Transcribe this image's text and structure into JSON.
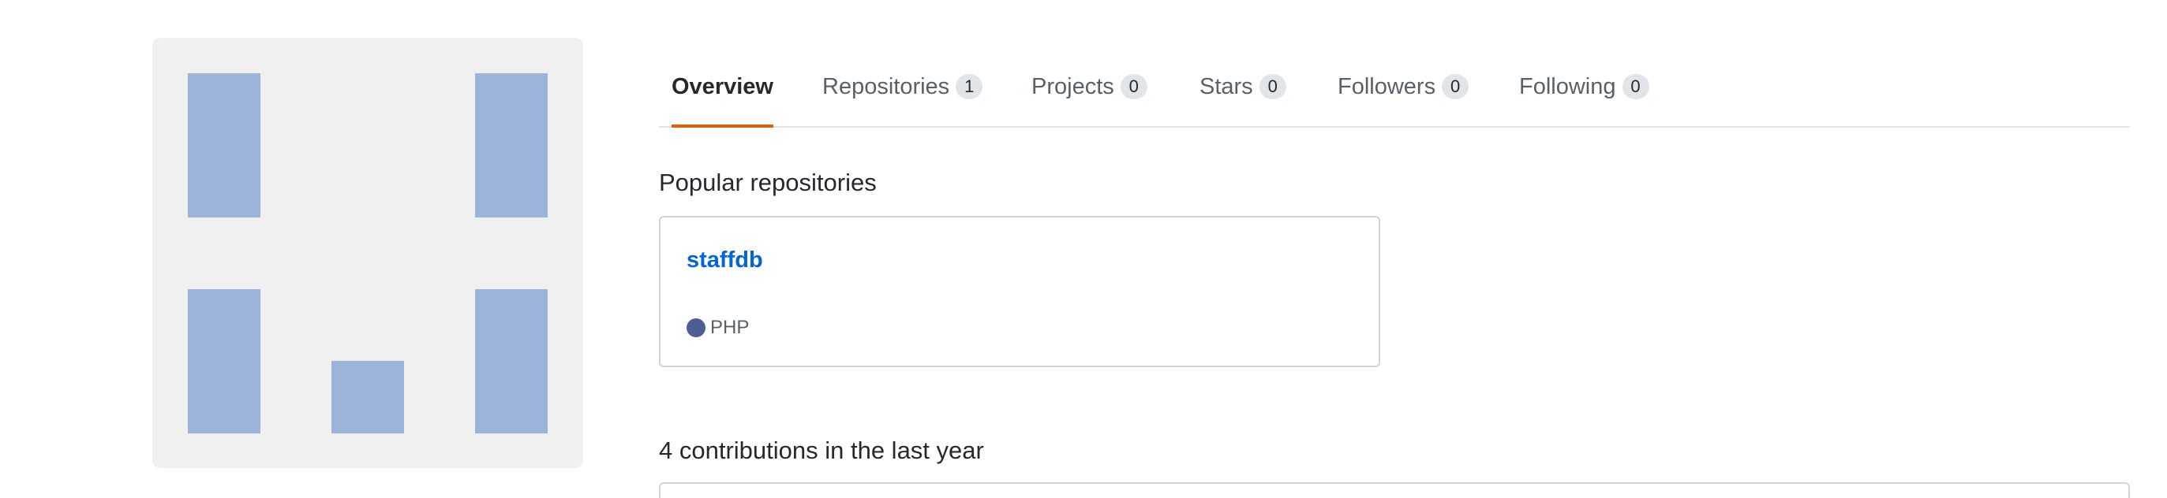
{
  "avatar": {
    "color": "#9db4da",
    "background": "#f0f0f0"
  },
  "tabs": [
    {
      "label": "Overview",
      "count": null,
      "active": true
    },
    {
      "label": "Repositories",
      "count": "1",
      "active": false
    },
    {
      "label": "Projects",
      "count": "0",
      "active": false
    },
    {
      "label": "Stars",
      "count": "0",
      "active": false
    },
    {
      "label": "Followers",
      "count": "0",
      "active": false
    },
    {
      "label": "Following",
      "count": "0",
      "active": false
    }
  ],
  "popular": {
    "heading": "Popular repositories",
    "repos": [
      {
        "name": "staffdb",
        "language": "PHP",
        "language_color": "#4F5D95"
      }
    ]
  },
  "contributions": {
    "heading": "4 contributions in the last year"
  },
  "colors": {
    "accent_underline": "#e36209",
    "link": "#0366d6"
  }
}
